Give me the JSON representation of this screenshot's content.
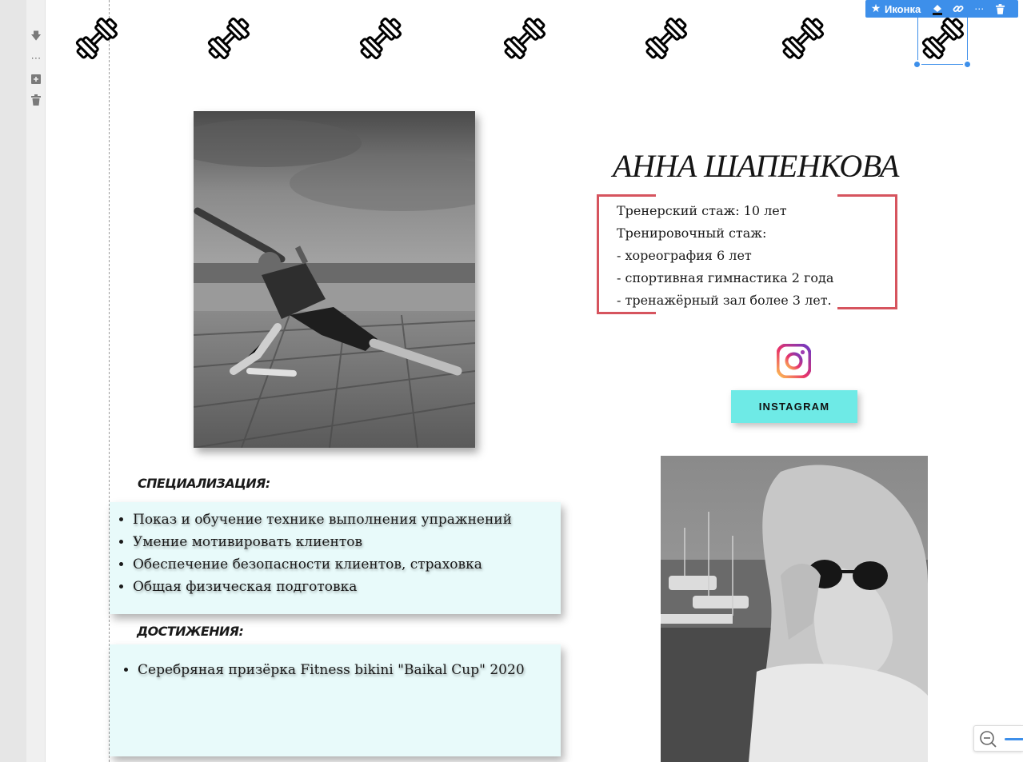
{
  "editor": {
    "toolbar": {
      "label": "Иконка",
      "star_icon": "star-icon",
      "fill_icon": "paint-bucket-icon",
      "link_icon": "link-icon",
      "more_icon": "more-icon",
      "delete_icon": "trash-icon"
    },
    "side_tools": [
      "arrow-down-icon",
      "more-icon",
      "duplicate-icon",
      "trash-icon"
    ],
    "selection_color": "#3d8fea"
  },
  "decor": {
    "dumbbell_icon": "dumbbell-icon"
  },
  "profile": {
    "name": "АННА ШАПЕНКОВА",
    "experience": [
      "Тренерский стаж: 10 лет",
      "Тренировочный стаж:",
      "- хореография 6 лет",
      "- спортивная гимнастика 2 года",
      "- тренажёрный зал более 3 лет."
    ],
    "frame_color": "#d6545e"
  },
  "social": {
    "instagram_label": "INSTAGRAM",
    "button_color": "#6eeae6"
  },
  "specialization": {
    "heading": "СПЕЦИАЛИЗАЦИЯ:",
    "items": [
      "Показ и обучение технике выполнения упражнений",
      " Умение мотивировать клиентов",
      "Обеспечение безопасности клиентов, страховка",
      "Общая физическая подготовка"
    ]
  },
  "achievements": {
    "heading": "ДОСТИЖЕНИЯ:",
    "items": [
      "Серебряная призёрка Fitness bikini \"Baikal Cup\" 2020"
    ]
  },
  "card_color": "#e8fafa",
  "zoom": {
    "out_icon": "zoom-out-icon"
  }
}
